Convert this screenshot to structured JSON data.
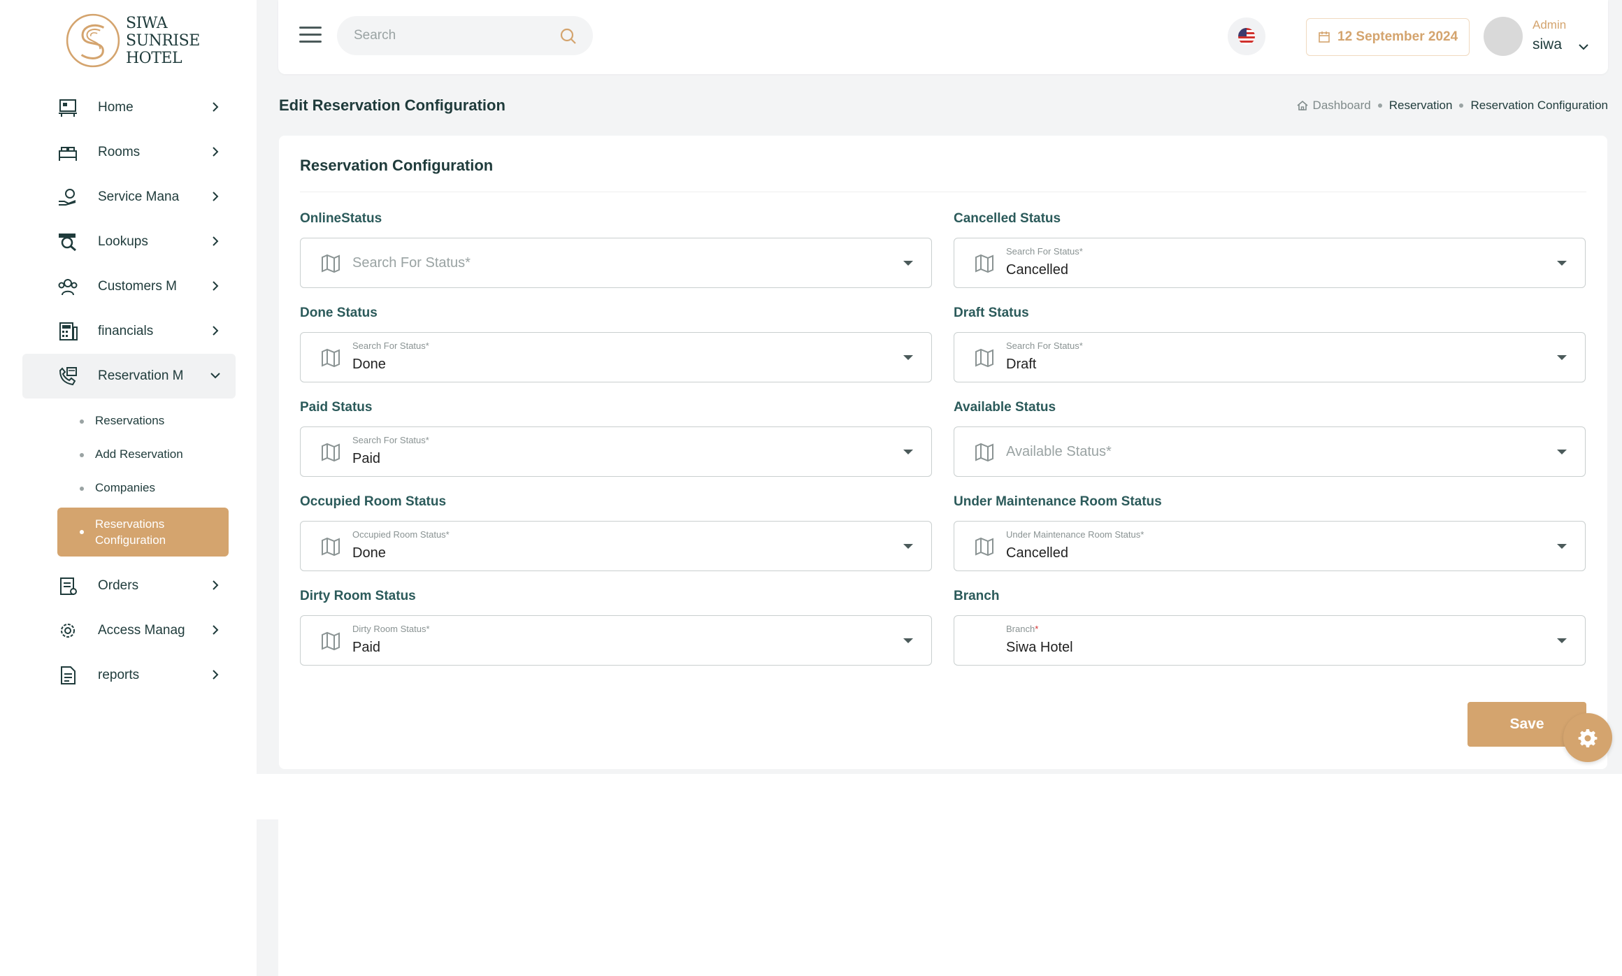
{
  "brand": {
    "logo_text": [
      "SIWA",
      "SUNRISE",
      "HOTEL"
    ],
    "accent_color": "#d4a46e",
    "text_color": "#1f3b3b"
  },
  "sidebar": {
    "items": [
      {
        "label": "Home",
        "icon": "home-desk-icon"
      },
      {
        "label": "Rooms",
        "icon": "bed-icon"
      },
      {
        "label": "Service Mana",
        "icon": "hand-service-icon"
      },
      {
        "label": "Lookups",
        "icon": "search-glass-icon"
      },
      {
        "label": "Customers M",
        "icon": "customers-icon"
      },
      {
        "label": "financials",
        "icon": "calculator-icon"
      },
      {
        "label": "Reservation M",
        "icon": "reservation-phone-icon"
      },
      {
        "label": "Orders",
        "icon": "orders-icon"
      },
      {
        "label": "Access Manag",
        "icon": "access-gear-icon"
      },
      {
        "label": "reports",
        "icon": "report-icon"
      }
    ],
    "reservation_subitems": [
      {
        "label": "Reservations"
      },
      {
        "label": "Add Reservation"
      },
      {
        "label": "Companies"
      },
      {
        "label": "Reservations Configuration",
        "active": true
      }
    ]
  },
  "topbar": {
    "search_placeholder": "Search",
    "date": "12 September 2024",
    "user_role": "Admin",
    "user_name": "siwa"
  },
  "page": {
    "title": "Edit Reservation Configuration",
    "breadcrumb": [
      "Dashboard",
      "Reservation",
      "Reservation Configuration"
    ]
  },
  "card": {
    "title": "Reservation Configuration",
    "fields": {
      "online": {
        "label": "OnlineStatus",
        "placeholder": "Search For Status*"
      },
      "cancelled": {
        "label": "Cancelled Status",
        "float_label": "Search For Status*",
        "value": "Cancelled"
      },
      "done": {
        "label": "Done Status",
        "float_label": "Search For Status*",
        "value": "Done"
      },
      "draft": {
        "label": "Draft Status",
        "float_label": "Search For Status*",
        "value": "Draft"
      },
      "paid": {
        "label": "Paid Status",
        "float_label": "Search For Status*",
        "value": "Paid"
      },
      "available": {
        "label": "Available Status",
        "placeholder": "Available Status*"
      },
      "occupied": {
        "label": "Occupied Room Status",
        "float_label": "Occupied Room Status*",
        "value": "Done"
      },
      "maintenance": {
        "label": "Under Maintenance Room Status",
        "float_label": "Under Maintenance Room Status*",
        "value": "Cancelled"
      },
      "dirty": {
        "label": "Dirty Room Status",
        "float_label": "Dirty Room Status*",
        "value": "Paid"
      },
      "branch": {
        "label": "Branch",
        "float_label": "Branch",
        "float_required": "*",
        "value": "Siwa Hotel"
      }
    },
    "save_label": "Save"
  }
}
